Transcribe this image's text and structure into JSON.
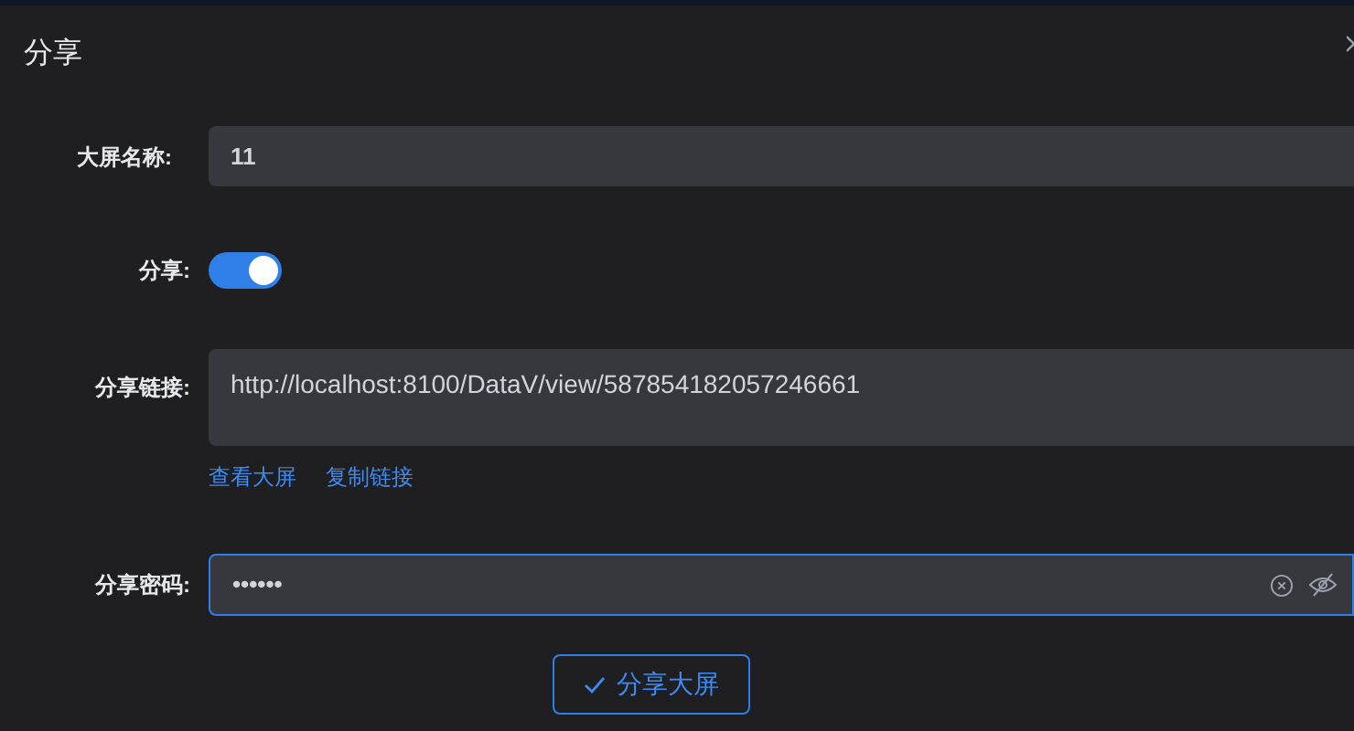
{
  "dialog": {
    "title": "分享"
  },
  "form": {
    "name": {
      "label": "大屏名称:",
      "value": "11"
    },
    "share": {
      "label": "分享:",
      "on": true
    },
    "link": {
      "label": "分享链接:",
      "value": "http://localhost:8100/DataV/view/587854182057246661",
      "actions": [
        "查看大屏",
        "复制链接"
      ]
    },
    "password": {
      "label": "分享密码:",
      "value": "••••••",
      "focused": true
    }
  },
  "submit": {
    "label": "分享大屏"
  }
}
